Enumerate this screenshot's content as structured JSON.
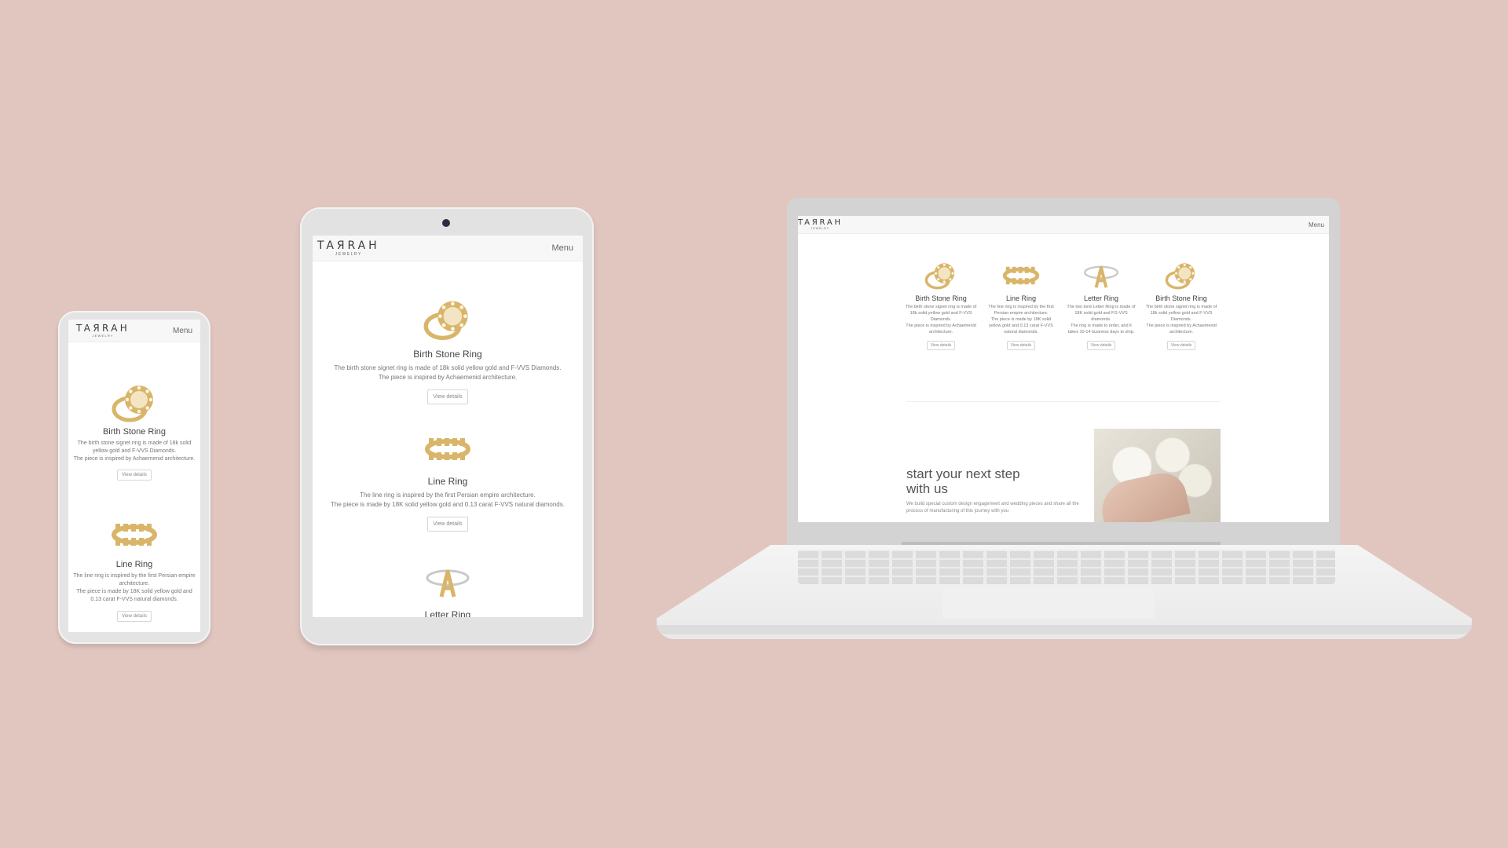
{
  "brand": {
    "logo_text": "TAЯRAH",
    "logo_sub": "JEWELRY"
  },
  "nav": {
    "menu_label": "Menu"
  },
  "products": [
    {
      "name": "Birth Stone Ring",
      "line1": "The birth stone signet ring is made of 18k solid yellow gold and F-VVS Diamonds.",
      "line2": "The piece is inspired by Achaemenid architecture.",
      "button": "View details",
      "icon": "signet-ring-icon"
    },
    {
      "name": "Line Ring",
      "line1": "The line ring is inspired by the first Persian empire architecture.",
      "line2": "The piece is made by 18K solid yellow gold and 0.13 carat F-VVS natural diamonds.",
      "button": "View details",
      "icon": "line-ring-icon"
    },
    {
      "name": "Letter Ring",
      "line1": "The two tone Letter Ring is made of 18K solid gold and FG-VVS diamonds.",
      "line2": "The ring is made to order, and it takes 10-14 business days to ship.",
      "button": "View details",
      "icon": "letter-ring-icon"
    },
    {
      "name": "Birth Stone Ring",
      "line1": "The birth stone signet ring is made of 18k solid yellow gold and F-VVS Diamonds.",
      "line2": "The piece is inspired by Achaemenid architecture.",
      "button": "View details",
      "icon": "signet-ring-icon"
    }
  ],
  "tablet_partial_title": "Letter Ring",
  "hero": {
    "title_line1": "start your next step",
    "title_line2": "with us",
    "subtitle": "We build special custom design engagement and wedding pieces and share all the process of manufacturing of this journey with you"
  },
  "colors": {
    "background": "#e1c6c0",
    "gold": "#d9b56a",
    "device": "#e2e2e2"
  }
}
